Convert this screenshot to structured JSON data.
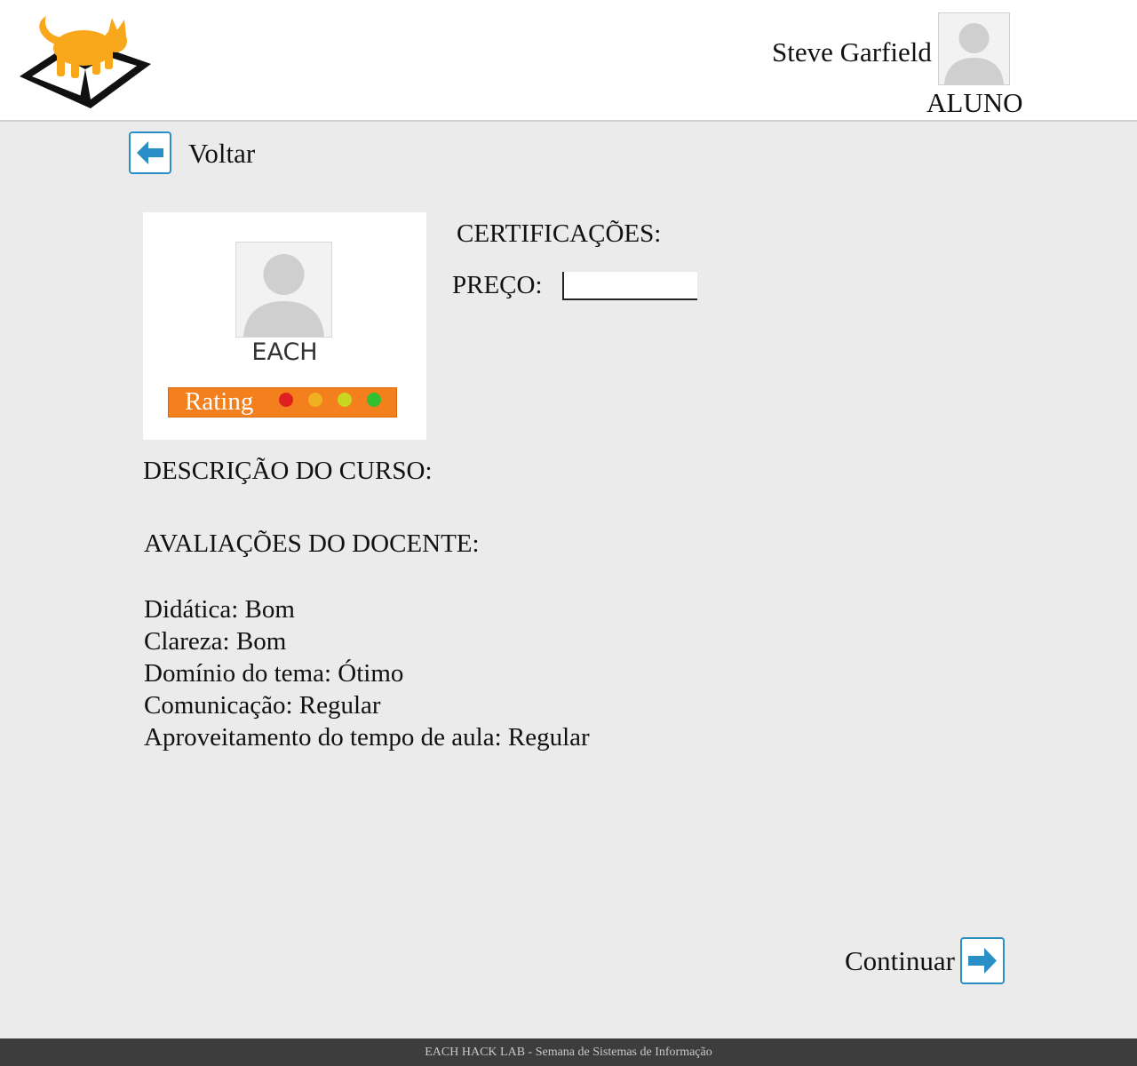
{
  "header": {
    "user_name": "Steve Garfield",
    "user_role": "ALUNO"
  },
  "nav": {
    "back_label": "Voltar"
  },
  "course": {
    "card_name": "EACH",
    "rating_label": "Rating",
    "rating_faces": [
      {
        "name": "bad",
        "color": "#e02020"
      },
      {
        "name": "ok",
        "color": "#f0b020"
      },
      {
        "name": "good",
        "color": "#c8d820"
      },
      {
        "name": "excellent",
        "color": "#30c030"
      }
    ],
    "certifications_label": "CERTIFICAÇÕES:",
    "price_label": "PREÇO:",
    "price_value": "",
    "description_label": "DESCRIÇÃO DO CURSO:"
  },
  "evaluations": {
    "title": "AVALIAÇÕES DO DOCENTE:",
    "items": [
      "Didática: Bom",
      "Clareza: Bom",
      "Domínio do tema: Ótimo",
      "Comunicação: Regular",
      "Aproveitamento do tempo de aula: Regular"
    ]
  },
  "actions": {
    "continue_label": "Continuar"
  },
  "footer": {
    "text": "EACH HACK LAB - Semana de Sistemas de Informação"
  },
  "colors": {
    "accent_blue": "#2a8fc6",
    "logo_orange": "#f9a81b",
    "rating_orange": "#f47f1d",
    "footer_bg": "#3d3d3d",
    "page_bg": "#ebebeb"
  }
}
